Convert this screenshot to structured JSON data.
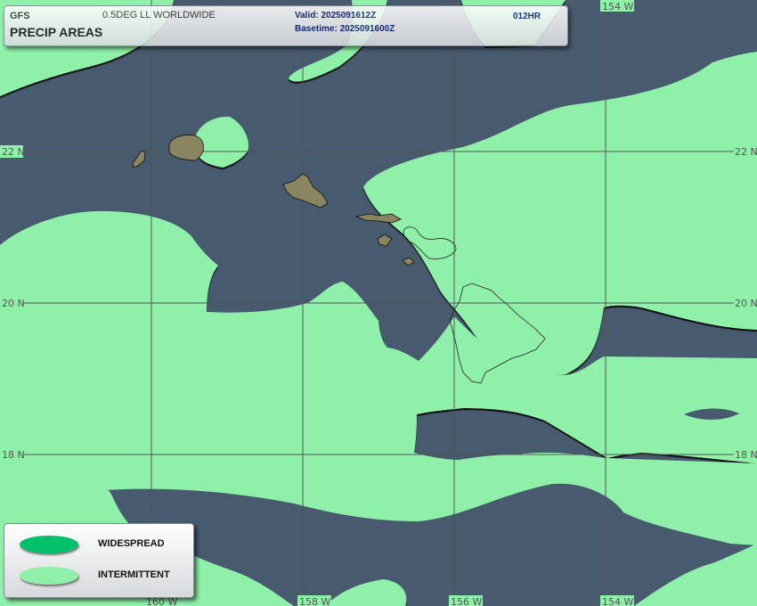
{
  "header": {
    "model": "GFS",
    "product": "PRECIP AREAS",
    "grid": "0.5DEG LL WORLDWIDE",
    "valid": "Valid: 2025091612Z",
    "basetime": "Basetime: 2025091600Z",
    "forecast_hour": "012HR"
  },
  "grid_labels": {
    "lat_22": "22 N",
    "lat_20": "20 N",
    "lat_18": "18 N",
    "lon_160": "160 W",
    "lon_158": "158 W",
    "lon_156": "156 W",
    "lon_154": "154 W"
  },
  "legend": {
    "widespread_label": "WIDESPREAD",
    "intermittent_label": "INTERMITTENT"
  },
  "colors": {
    "ocean": "#475a6e",
    "intermittent": "#8ef0a9",
    "widespread": "#05c06a",
    "land": "#8a8460"
  }
}
